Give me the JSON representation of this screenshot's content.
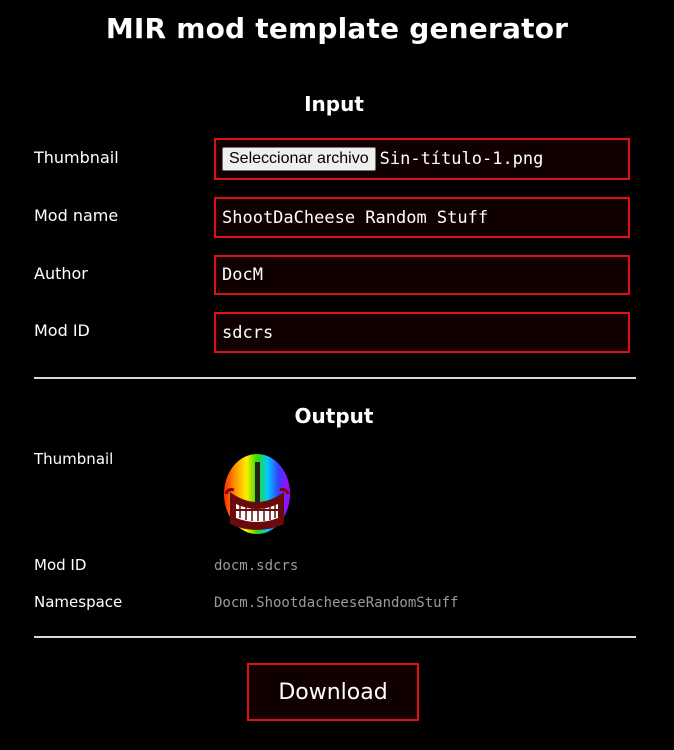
{
  "header": {
    "title": "MIR mod template generator"
  },
  "input": {
    "heading": "Input",
    "thumbnail": {
      "label": "Thumbnail",
      "button": "Seleccionar archivo",
      "file_name": "Sin-título-1.png"
    },
    "mod_name": {
      "label": "Mod name",
      "value": "ShootDaCheese Random Stuff"
    },
    "author": {
      "label": "Author",
      "value": "DocM"
    },
    "mod_id": {
      "label": "Mod ID",
      "value": "sdcrs"
    }
  },
  "output": {
    "heading": "Output",
    "thumbnail_label": "Thumbnail",
    "mod_id": {
      "label": "Mod ID",
      "value": "docm.sdcrs"
    },
    "namespace": {
      "label": "Namespace",
      "value": "Docm.ShootdacheeseRandomStuff"
    }
  },
  "actions": {
    "download_label": "Download"
  },
  "colors": {
    "accent": "#e01010",
    "field_bg": "#110000",
    "background": "#000000"
  }
}
